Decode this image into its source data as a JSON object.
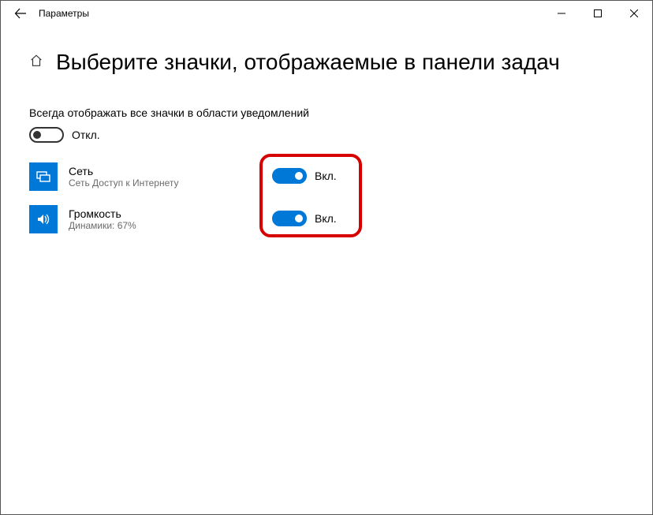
{
  "titlebar": {
    "title": "Параметры"
  },
  "page": {
    "title": "Выберите значки, отображаемые в панели задач"
  },
  "always_show": {
    "label": "Всегда отображать все значки в области уведомлений",
    "state_label": "Откл."
  },
  "items": [
    {
      "name": "Сеть",
      "desc": "Сеть Доступ к Интернету",
      "state_label": "Вкл."
    },
    {
      "name": "Громкость",
      "desc": "Динамики: 67%",
      "state_label": "Вкл."
    }
  ]
}
